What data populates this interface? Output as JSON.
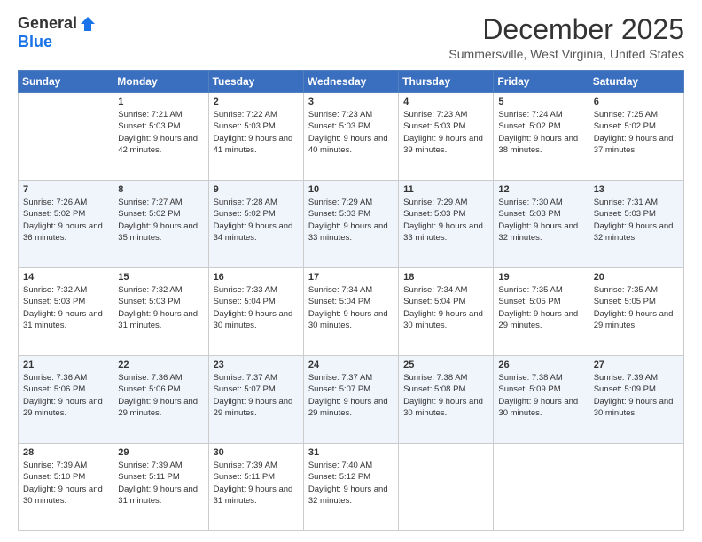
{
  "header": {
    "logo_general": "General",
    "logo_blue": "Blue",
    "month_title": "December 2025",
    "location": "Summersville, West Virginia, United States"
  },
  "calendar": {
    "headers": [
      "Sunday",
      "Monday",
      "Tuesday",
      "Wednesday",
      "Thursday",
      "Friday",
      "Saturday"
    ],
    "weeks": [
      [
        {
          "day": "",
          "sunrise": "",
          "sunset": "",
          "daylight": ""
        },
        {
          "day": "1",
          "sunrise": "Sunrise: 7:21 AM",
          "sunset": "Sunset: 5:03 PM",
          "daylight": "Daylight: 9 hours and 42 minutes."
        },
        {
          "day": "2",
          "sunrise": "Sunrise: 7:22 AM",
          "sunset": "Sunset: 5:03 PM",
          "daylight": "Daylight: 9 hours and 41 minutes."
        },
        {
          "day": "3",
          "sunrise": "Sunrise: 7:23 AM",
          "sunset": "Sunset: 5:03 PM",
          "daylight": "Daylight: 9 hours and 40 minutes."
        },
        {
          "day": "4",
          "sunrise": "Sunrise: 7:23 AM",
          "sunset": "Sunset: 5:03 PM",
          "daylight": "Daylight: 9 hours and 39 minutes."
        },
        {
          "day": "5",
          "sunrise": "Sunrise: 7:24 AM",
          "sunset": "Sunset: 5:02 PM",
          "daylight": "Daylight: 9 hours and 38 minutes."
        },
        {
          "day": "6",
          "sunrise": "Sunrise: 7:25 AM",
          "sunset": "Sunset: 5:02 PM",
          "daylight": "Daylight: 9 hours and 37 minutes."
        }
      ],
      [
        {
          "day": "7",
          "sunrise": "Sunrise: 7:26 AM",
          "sunset": "Sunset: 5:02 PM",
          "daylight": "Daylight: 9 hours and 36 minutes."
        },
        {
          "day": "8",
          "sunrise": "Sunrise: 7:27 AM",
          "sunset": "Sunset: 5:02 PM",
          "daylight": "Daylight: 9 hours and 35 minutes."
        },
        {
          "day": "9",
          "sunrise": "Sunrise: 7:28 AM",
          "sunset": "Sunset: 5:02 PM",
          "daylight": "Daylight: 9 hours and 34 minutes."
        },
        {
          "day": "10",
          "sunrise": "Sunrise: 7:29 AM",
          "sunset": "Sunset: 5:03 PM",
          "daylight": "Daylight: 9 hours and 33 minutes."
        },
        {
          "day": "11",
          "sunrise": "Sunrise: 7:29 AM",
          "sunset": "Sunset: 5:03 PM",
          "daylight": "Daylight: 9 hours and 33 minutes."
        },
        {
          "day": "12",
          "sunrise": "Sunrise: 7:30 AM",
          "sunset": "Sunset: 5:03 PM",
          "daylight": "Daylight: 9 hours and 32 minutes."
        },
        {
          "day": "13",
          "sunrise": "Sunrise: 7:31 AM",
          "sunset": "Sunset: 5:03 PM",
          "daylight": "Daylight: 9 hours and 32 minutes."
        }
      ],
      [
        {
          "day": "14",
          "sunrise": "Sunrise: 7:32 AM",
          "sunset": "Sunset: 5:03 PM",
          "daylight": "Daylight: 9 hours and 31 minutes."
        },
        {
          "day": "15",
          "sunrise": "Sunrise: 7:32 AM",
          "sunset": "Sunset: 5:03 PM",
          "daylight": "Daylight: 9 hours and 31 minutes."
        },
        {
          "day": "16",
          "sunrise": "Sunrise: 7:33 AM",
          "sunset": "Sunset: 5:04 PM",
          "daylight": "Daylight: 9 hours and 30 minutes."
        },
        {
          "day": "17",
          "sunrise": "Sunrise: 7:34 AM",
          "sunset": "Sunset: 5:04 PM",
          "daylight": "Daylight: 9 hours and 30 minutes."
        },
        {
          "day": "18",
          "sunrise": "Sunrise: 7:34 AM",
          "sunset": "Sunset: 5:04 PM",
          "daylight": "Daylight: 9 hours and 30 minutes."
        },
        {
          "day": "19",
          "sunrise": "Sunrise: 7:35 AM",
          "sunset": "Sunset: 5:05 PM",
          "daylight": "Daylight: 9 hours and 29 minutes."
        },
        {
          "day": "20",
          "sunrise": "Sunrise: 7:35 AM",
          "sunset": "Sunset: 5:05 PM",
          "daylight": "Daylight: 9 hours and 29 minutes."
        }
      ],
      [
        {
          "day": "21",
          "sunrise": "Sunrise: 7:36 AM",
          "sunset": "Sunset: 5:06 PM",
          "daylight": "Daylight: 9 hours and 29 minutes."
        },
        {
          "day": "22",
          "sunrise": "Sunrise: 7:36 AM",
          "sunset": "Sunset: 5:06 PM",
          "daylight": "Daylight: 9 hours and 29 minutes."
        },
        {
          "day": "23",
          "sunrise": "Sunrise: 7:37 AM",
          "sunset": "Sunset: 5:07 PM",
          "daylight": "Daylight: 9 hours and 29 minutes."
        },
        {
          "day": "24",
          "sunrise": "Sunrise: 7:37 AM",
          "sunset": "Sunset: 5:07 PM",
          "daylight": "Daylight: 9 hours and 29 minutes."
        },
        {
          "day": "25",
          "sunrise": "Sunrise: 7:38 AM",
          "sunset": "Sunset: 5:08 PM",
          "daylight": "Daylight: 9 hours and 30 minutes."
        },
        {
          "day": "26",
          "sunrise": "Sunrise: 7:38 AM",
          "sunset": "Sunset: 5:09 PM",
          "daylight": "Daylight: 9 hours and 30 minutes."
        },
        {
          "day": "27",
          "sunrise": "Sunrise: 7:39 AM",
          "sunset": "Sunset: 5:09 PM",
          "daylight": "Daylight: 9 hours and 30 minutes."
        }
      ],
      [
        {
          "day": "28",
          "sunrise": "Sunrise: 7:39 AM",
          "sunset": "Sunset: 5:10 PM",
          "daylight": "Daylight: 9 hours and 30 minutes."
        },
        {
          "day": "29",
          "sunrise": "Sunrise: 7:39 AM",
          "sunset": "Sunset: 5:11 PM",
          "daylight": "Daylight: 9 hours and 31 minutes."
        },
        {
          "day": "30",
          "sunrise": "Sunrise: 7:39 AM",
          "sunset": "Sunset: 5:11 PM",
          "daylight": "Daylight: 9 hours and 31 minutes."
        },
        {
          "day": "31",
          "sunrise": "Sunrise: 7:40 AM",
          "sunset": "Sunset: 5:12 PM",
          "daylight": "Daylight: 9 hours and 32 minutes."
        },
        {
          "day": "",
          "sunrise": "",
          "sunset": "",
          "daylight": ""
        },
        {
          "day": "",
          "sunrise": "",
          "sunset": "",
          "daylight": ""
        },
        {
          "day": "",
          "sunrise": "",
          "sunset": "",
          "daylight": ""
        }
      ]
    ]
  }
}
